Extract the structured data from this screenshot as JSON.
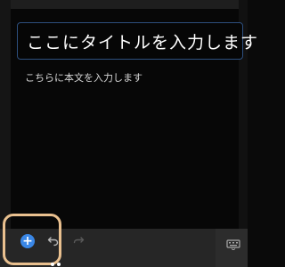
{
  "editor": {
    "title_value": "ここにタイトルを入力します",
    "body_value": "こちらに本文を入力します"
  },
  "toolbar": {
    "add_icon": "plus-circle-icon",
    "add_glyph": "+",
    "undo_icon": "undo-icon",
    "redo_icon": "redo-icon",
    "keyboard_icon": "keyboard-icon"
  },
  "colors": {
    "background": "#070707",
    "title_border": "#2d4f7e",
    "caret": "#4d8ee8",
    "toolbar": "#262626",
    "add_button": "#3a87e6",
    "highlight_ring": "#e9c08f"
  }
}
